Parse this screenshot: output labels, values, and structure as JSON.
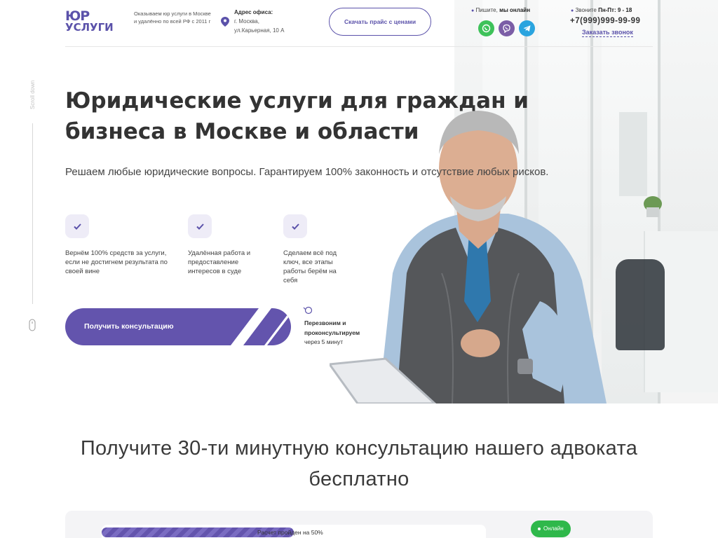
{
  "header": {
    "logo_line1": "ЮР",
    "logo_line2": "УСЛУГИ",
    "tagline": "Оказываем юр услуги в Москве и удалённо по всей РФ с 2011 г",
    "address_title": "Адрес офиса:",
    "address_line1": "г. Москва,",
    "address_line2": "ул.Карьерная, 10 А",
    "price_button": "Скачать прайс с ценами",
    "write_prefix": "Пишите,",
    "write_bold": "мы онлайн",
    "messengers": [
      "whatsapp-icon",
      "viber-icon",
      "telegram-icon"
    ],
    "call_prefix": "Звоните",
    "call_hours": "Пн-Пт: 9 - 18",
    "phone": "+7(999)999-99-99",
    "order_call": "Заказать звонок"
  },
  "scroll": {
    "label": "Scroll down"
  },
  "hero": {
    "title": "Юридические услуги для граждан и бизнеса в Москве и области",
    "lead": "Решаем любые юридические вопросы. Гарантируем 100% законность и отсутствие любых рисков.",
    "features": [
      {
        "text": "Вернём 100% средств за услуги, если не достигнем результата по своей вине"
      },
      {
        "text": "Удалённая работа и предоставление интересов в суде"
      },
      {
        "text": "Сделаем всё под ключ, все этапы работы берём на себя"
      }
    ],
    "cta_label": "Получить консультацию",
    "recall_bold": "Перезвоним и проконсультируем",
    "recall_rest": "через 5 минут"
  },
  "consult": {
    "title": "Получите 30-ти минутную консультацию нашего адвоката бесплатно",
    "progress_text": "Расчет пройден на 50%",
    "progress_percent": 50,
    "online_label": "Онлайн"
  },
  "colors": {
    "accent": "#5b52aa",
    "cta": "#6354ad",
    "online": "#2fb84b",
    "whatsapp": "#3ec25a",
    "viber": "#7b5ea6",
    "telegram": "#2aa4df"
  }
}
